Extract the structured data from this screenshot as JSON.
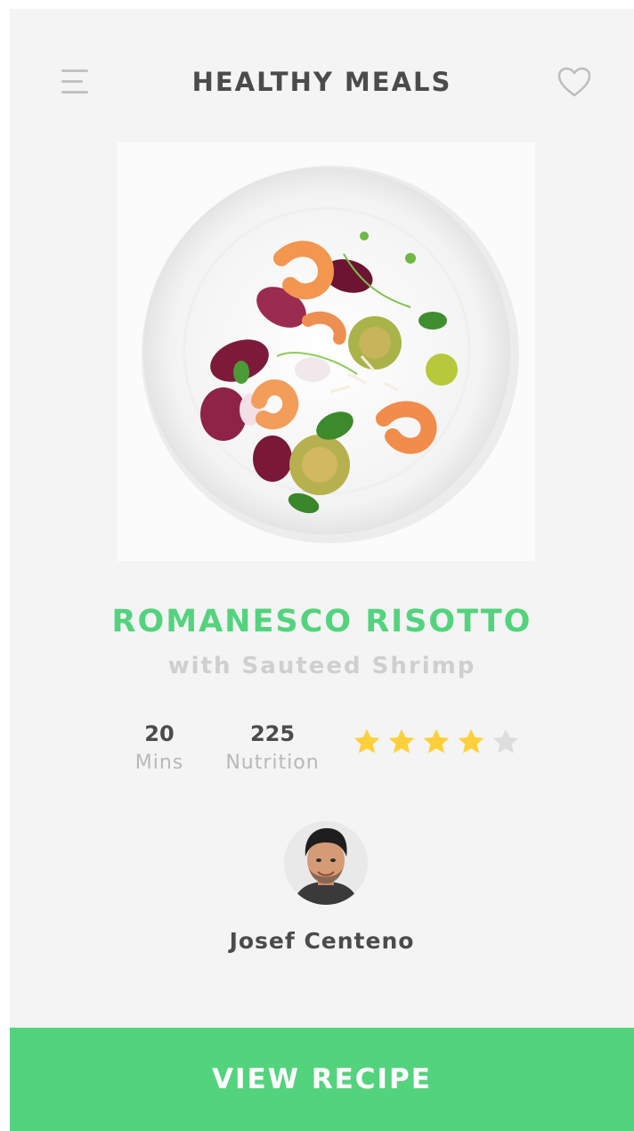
{
  "header": {
    "title": "HEALTHY MEALS",
    "menu_icon": "hamburger-menu-icon",
    "favorite_icon": "heart-outline-icon"
  },
  "recipe": {
    "name": "ROMANESCO RISOTTO",
    "subtitle": "with Sauteed Shrimp",
    "image": "dish-photo"
  },
  "stats": {
    "time_value": "20",
    "time_label": "Mins",
    "nutrition_value": "225",
    "nutrition_label": "Nutrition"
  },
  "rating": {
    "value": 4,
    "max": 5,
    "filled_color": "#fdd03b",
    "empty_color": "#dedede"
  },
  "author": {
    "name": "Josef Centeno"
  },
  "cta": {
    "label": "VIEW RECIPE",
    "color": "#53d37d"
  },
  "colors": {
    "accent": "#53d37d",
    "text_dark": "#4b4b4b",
    "text_muted": "#cfcfcf",
    "background": "#f4f4f4"
  }
}
